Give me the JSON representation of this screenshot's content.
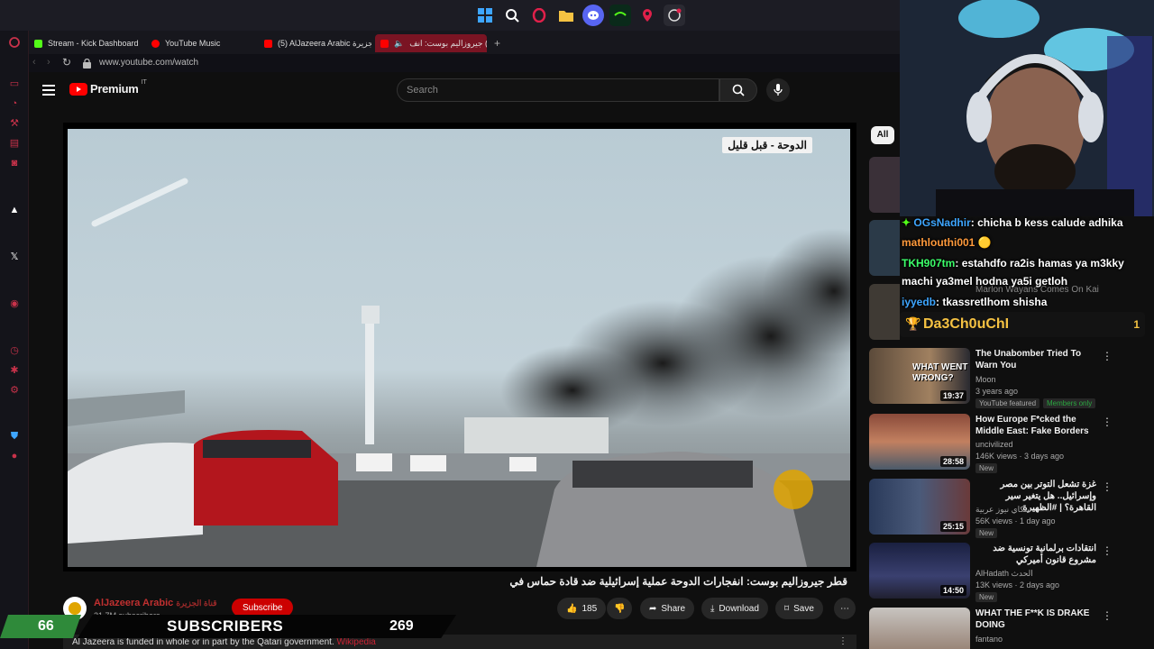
{
  "browser": {
    "tabs": [
      {
        "label": "Stream - Kick Dashboard",
        "color": "#53fc18"
      },
      {
        "label": "YouTube Music",
        "color": "#ff0000"
      },
      {
        "label": "(5) AlJazeera Arabic قناة الجزيرة",
        "color": "#ff0000"
      },
      {
        "label": "(5) جيروزاليم بوست: انف",
        "color": "#ff0000"
      }
    ],
    "new_tab": "+",
    "url": "www.youtube.com/watch"
  },
  "youtube": {
    "logo_text": "Premium",
    "logo_region": "IT",
    "search_placeholder": "Search",
    "video_overlay_label": "الدوحة - قبل قليل",
    "video_title": "قطر جيروزاليم بوست: انفجارات الدوحة عملية إسرائيلية ضد قادة حماس في",
    "channel": {
      "name": "AlJazeera Arabic",
      "name_ar": "قناة الجزيرة",
      "subscribers": "21.7M subscribers"
    },
    "subscribe_label": "Subscribe",
    "actions": {
      "likes": "185",
      "share": "Share",
      "download": "Download",
      "save": "Save"
    },
    "funding_notice": "Al Jazeera is funded in whole or in part by the Qatari government.",
    "funding_link": "Wikipedia",
    "chip_all": "All"
  },
  "stream_overlay": {
    "sub_goal_current": "66",
    "label": "SUBSCRIBERS",
    "sub_goal_target": "269"
  },
  "recommendations": [
    {
      "title": "The Unabomber Tried To Warn You",
      "channel": "Moon",
      "meta": "3 years ago",
      "badge1": "YouTube featured",
      "badge2": "Members only",
      "duration": "19:37",
      "thumb_text": "WHAT WENT WRONG?",
      "rtl": false
    },
    {
      "title": "How Europe F*cked the Middle East: Fake Borders",
      "channel": "uncivilized",
      "meta": "146K views · 3 days ago",
      "badge1": "New",
      "duration": "28:58",
      "rtl": false
    },
    {
      "title": "غزة تشعل التوتر بين مصر وإسرائيل.. هل يتغير سير القاهرة؟ | #الظهيرة",
      "channel": "سكاي نيوز عربية",
      "meta": "56K views · 1 day ago",
      "badge1": "New",
      "duration": "25:15",
      "rtl": true
    },
    {
      "title": "انتقادات برلمانية تونسية ضد مشروع قانون أميركي",
      "channel": "AlHadath الحدث",
      "meta": "13K views · 2 days ago",
      "badge1": "New",
      "duration": "14:50",
      "rtl": true
    },
    {
      "title": "WHAT THE F**K IS DRAKE DOING",
      "channel": "fantano",
      "meta": "",
      "duration": "",
      "rtl": false
    }
  ],
  "hidden_rec_titles": [
    "Marlon Wayans Comes On Kai"
  ],
  "chat": [
    {
      "user": "OGsNadhir",
      "text": ": chicha b kess calude adhika",
      "color": "#3ea6ff"
    },
    {
      "user": "mathlouthi001",
      "text": "",
      "color": "#ff9a3c"
    },
    {
      "user": "TKH907tm",
      "text": ": estahdfo ra2is hamas ya m3kky",
      "color": "#3cff6a"
    },
    {
      "user": "",
      "text": "machi ya3mel hodna ya5i getloh",
      "color": "#ffffff"
    },
    {
      "user": "iyyedb",
      "text": ": tkassretlhom shisha",
      "color": "#3ea6ff"
    }
  ],
  "leaderboard": {
    "name": "Da3Ch0uChI",
    "rank": "1"
  }
}
